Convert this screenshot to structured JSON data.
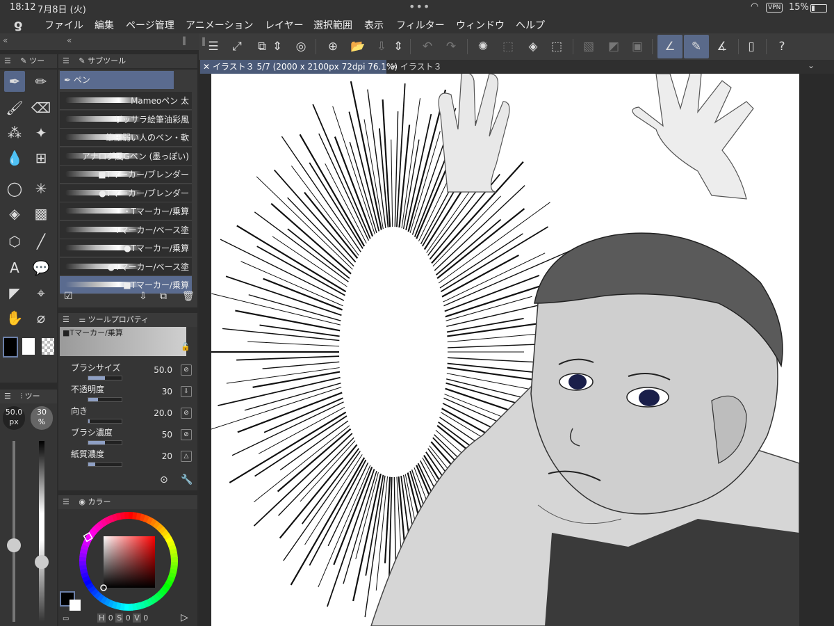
{
  "status": {
    "time": "18:12",
    "date": "7月8日 (火)",
    "vpn": "VPN",
    "battery": "15%"
  },
  "menu": [
    "ファイル",
    "編集",
    "ページ管理",
    "アニメーション",
    "レイヤー",
    "選択範囲",
    "表示",
    "フィルター",
    "ウィンドウ",
    "ヘルプ"
  ],
  "panels": {
    "tool_header": "ツー",
    "subtool_header": "サブツール",
    "subtool_group": "ペン",
    "props_header": "ツールプロパティ",
    "color_header": "カラー",
    "size_header": "ツー"
  },
  "tabs": [
    {
      "label": "イラスト３ 5/7 (2000 x 2100px 72dpi 76.1%)",
      "active": true
    },
    {
      "label": "イラスト３",
      "active": false
    }
  ],
  "brushes": [
    {
      "label": "Mameoペン 太"
    },
    {
      "label": "ザッサラ絵筆油彩風"
    },
    {
      "label": "筆圧弱い人のペン・軟"
    },
    {
      "label": "アナログ風Gペン (墨っぽい)"
    },
    {
      "label": "■Tマーカー/ブレンダー"
    },
    {
      "label": "●Tマーカー/ブレンダー"
    },
    {
      "label": "・Tマーカー/乗算"
    },
    {
      "label": "・Tマーカー/ベース塗"
    },
    {
      "label": "●Tマーカー/乗算"
    },
    {
      "label": "●Tマーカー/ベース塗"
    },
    {
      "label": "■Tマーカー/乗算",
      "selected": true
    }
  ],
  "tool_property": {
    "brush_name": "■Tマーカー/乗算",
    "props": [
      {
        "name": "ブラシサイズ",
        "value": "50.0",
        "level": 0.5
      },
      {
        "name": "不透明度",
        "value": "30",
        "level": 0.3
      },
      {
        "name": "向き",
        "value": "20.0",
        "level": 0.05
      },
      {
        "name": "ブラシ濃度",
        "value": "50",
        "level": 0.5
      },
      {
        "name": "紙質濃度",
        "value": "20",
        "level": 0.2
      }
    ]
  },
  "size_panel": {
    "size_value": "50.0",
    "size_unit": "px",
    "opacity_value": "30",
    "opacity_unit": "%"
  },
  "color": {
    "h_label": "H",
    "h": "0",
    "s_label": "S",
    "s": "0",
    "v_label": "V",
    "v": "0"
  },
  "colors": {
    "accent": "#56678a",
    "panel": "#363636",
    "bg": "#2b2b2b"
  }
}
